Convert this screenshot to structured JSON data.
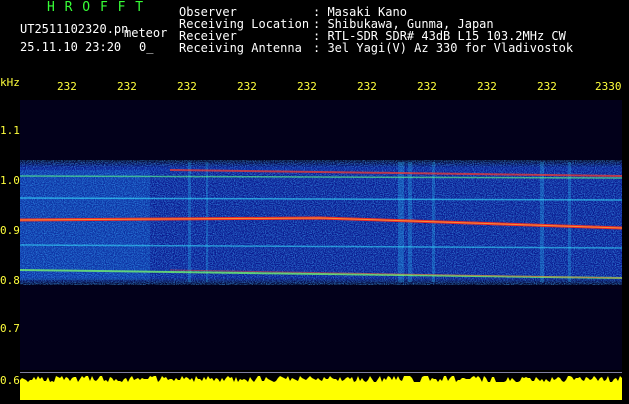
{
  "header": {
    "title": "H R O F F T",
    "filename": "UT2511102320.pn",
    "meteor_label": "meteor",
    "datetime": "25.11.10 23:20",
    "count": "0_"
  },
  "info": [
    {
      "label": "Observer",
      "value": ": Masaki Kano"
    },
    {
      "label": "Receiving Location",
      "value": ": Shibukawa, Gunma, Japan"
    },
    {
      "label": "Receiver",
      "value": ": RTL-SDR SDR# 43dB L15 103.2MHz CW"
    },
    {
      "label": "Receiving Antenna",
      "value": ": 3el Yagi(V) Az 330 for Vladivostok"
    }
  ],
  "axis": {
    "y_unit": "kHz",
    "y_ticks": [
      "1.1",
      "1.0",
      "0.9",
      "0.8",
      "0.7",
      "0.6"
    ],
    "x_ticks": [
      "232",
      "232",
      "232",
      "232",
      "232",
      "232",
      "232",
      "232",
      "232",
      "2330"
    ]
  },
  "colors": {
    "background": "#000000",
    "plot_bg": "#02001a",
    "text_white": "#ffffff",
    "text_green": "#37ff37",
    "text_yellow": "#ffff3c",
    "power_trace": "#ffff00"
  }
}
